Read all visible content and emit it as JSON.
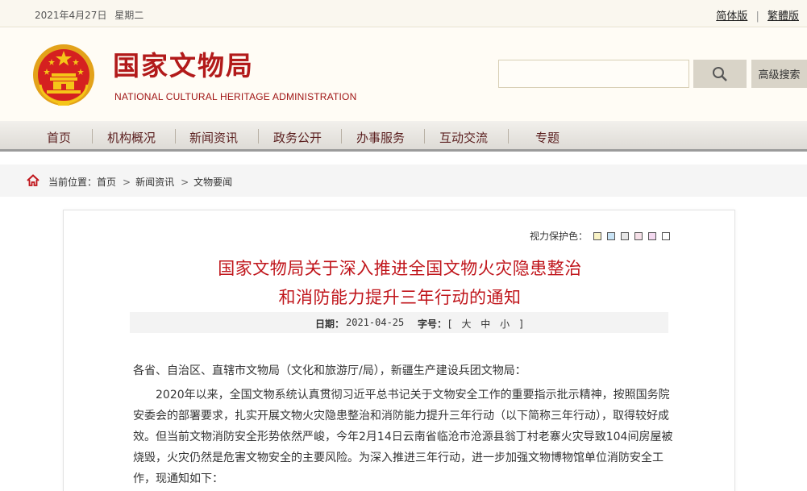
{
  "topbar": {
    "date": "2021年4月27日",
    "weekday": "星期二",
    "lang_simplified": "简体版",
    "lang_traditional": "繁體版",
    "separator": "|"
  },
  "header": {
    "title": "国家文物局",
    "subtitle": "NATIONAL CULTURAL HERITAGE ADMINISTRATION",
    "search_placeholder": "",
    "advanced_search": "高级搜索"
  },
  "nav": {
    "items": [
      "首页",
      "机构概况",
      "新闻资讯",
      "政务公开",
      "办事服务",
      "互动交流",
      "专题"
    ]
  },
  "breadcrumb": {
    "prefix": "当前位置：",
    "items": [
      "首页",
      "新闻资讯",
      "文物要闻"
    ],
    "arrow": ">"
  },
  "article": {
    "eye_label": "视力保护色：",
    "eye_colors": [
      "#f9f3c6",
      "#c8e3f5",
      "#e6e6e6",
      "#f6e0e8",
      "#f3d8ef",
      "#ffffff"
    ],
    "title_line1": "国家文物局关于深入推进全国文物火灾隐患整治",
    "title_line2": "和消防能力提升三年行动的通知",
    "date_label": "日期：",
    "date_value": "2021-04-25",
    "size_label": "字号：",
    "size_value": "[ 大 中 小 ]",
    "salutation": "各省、自治区、直辖市文物局（文化和旅游厅/局），新疆生产建设兵团文物局：",
    "paragraph": "2020年以来，全国文物系统认真贯彻习近平总书记关于文物安全工作的重要指示批示精神，按照国务院安委会的部署要求，扎实开展文物火灾隐患整治和消防能力提升三年行动（以下简称三年行动），取得较好成效。但当前文物消防安全形势依然严峻，今年2月14日云南省临沧市沧源县翁丁村老寨火灾导致104间房屋被烧毁，火灾仍然是危害文物安全的主要风险。为深入推进三年行动，进一步加强文物博物馆单位消防安全工作，现通知如下："
  }
}
